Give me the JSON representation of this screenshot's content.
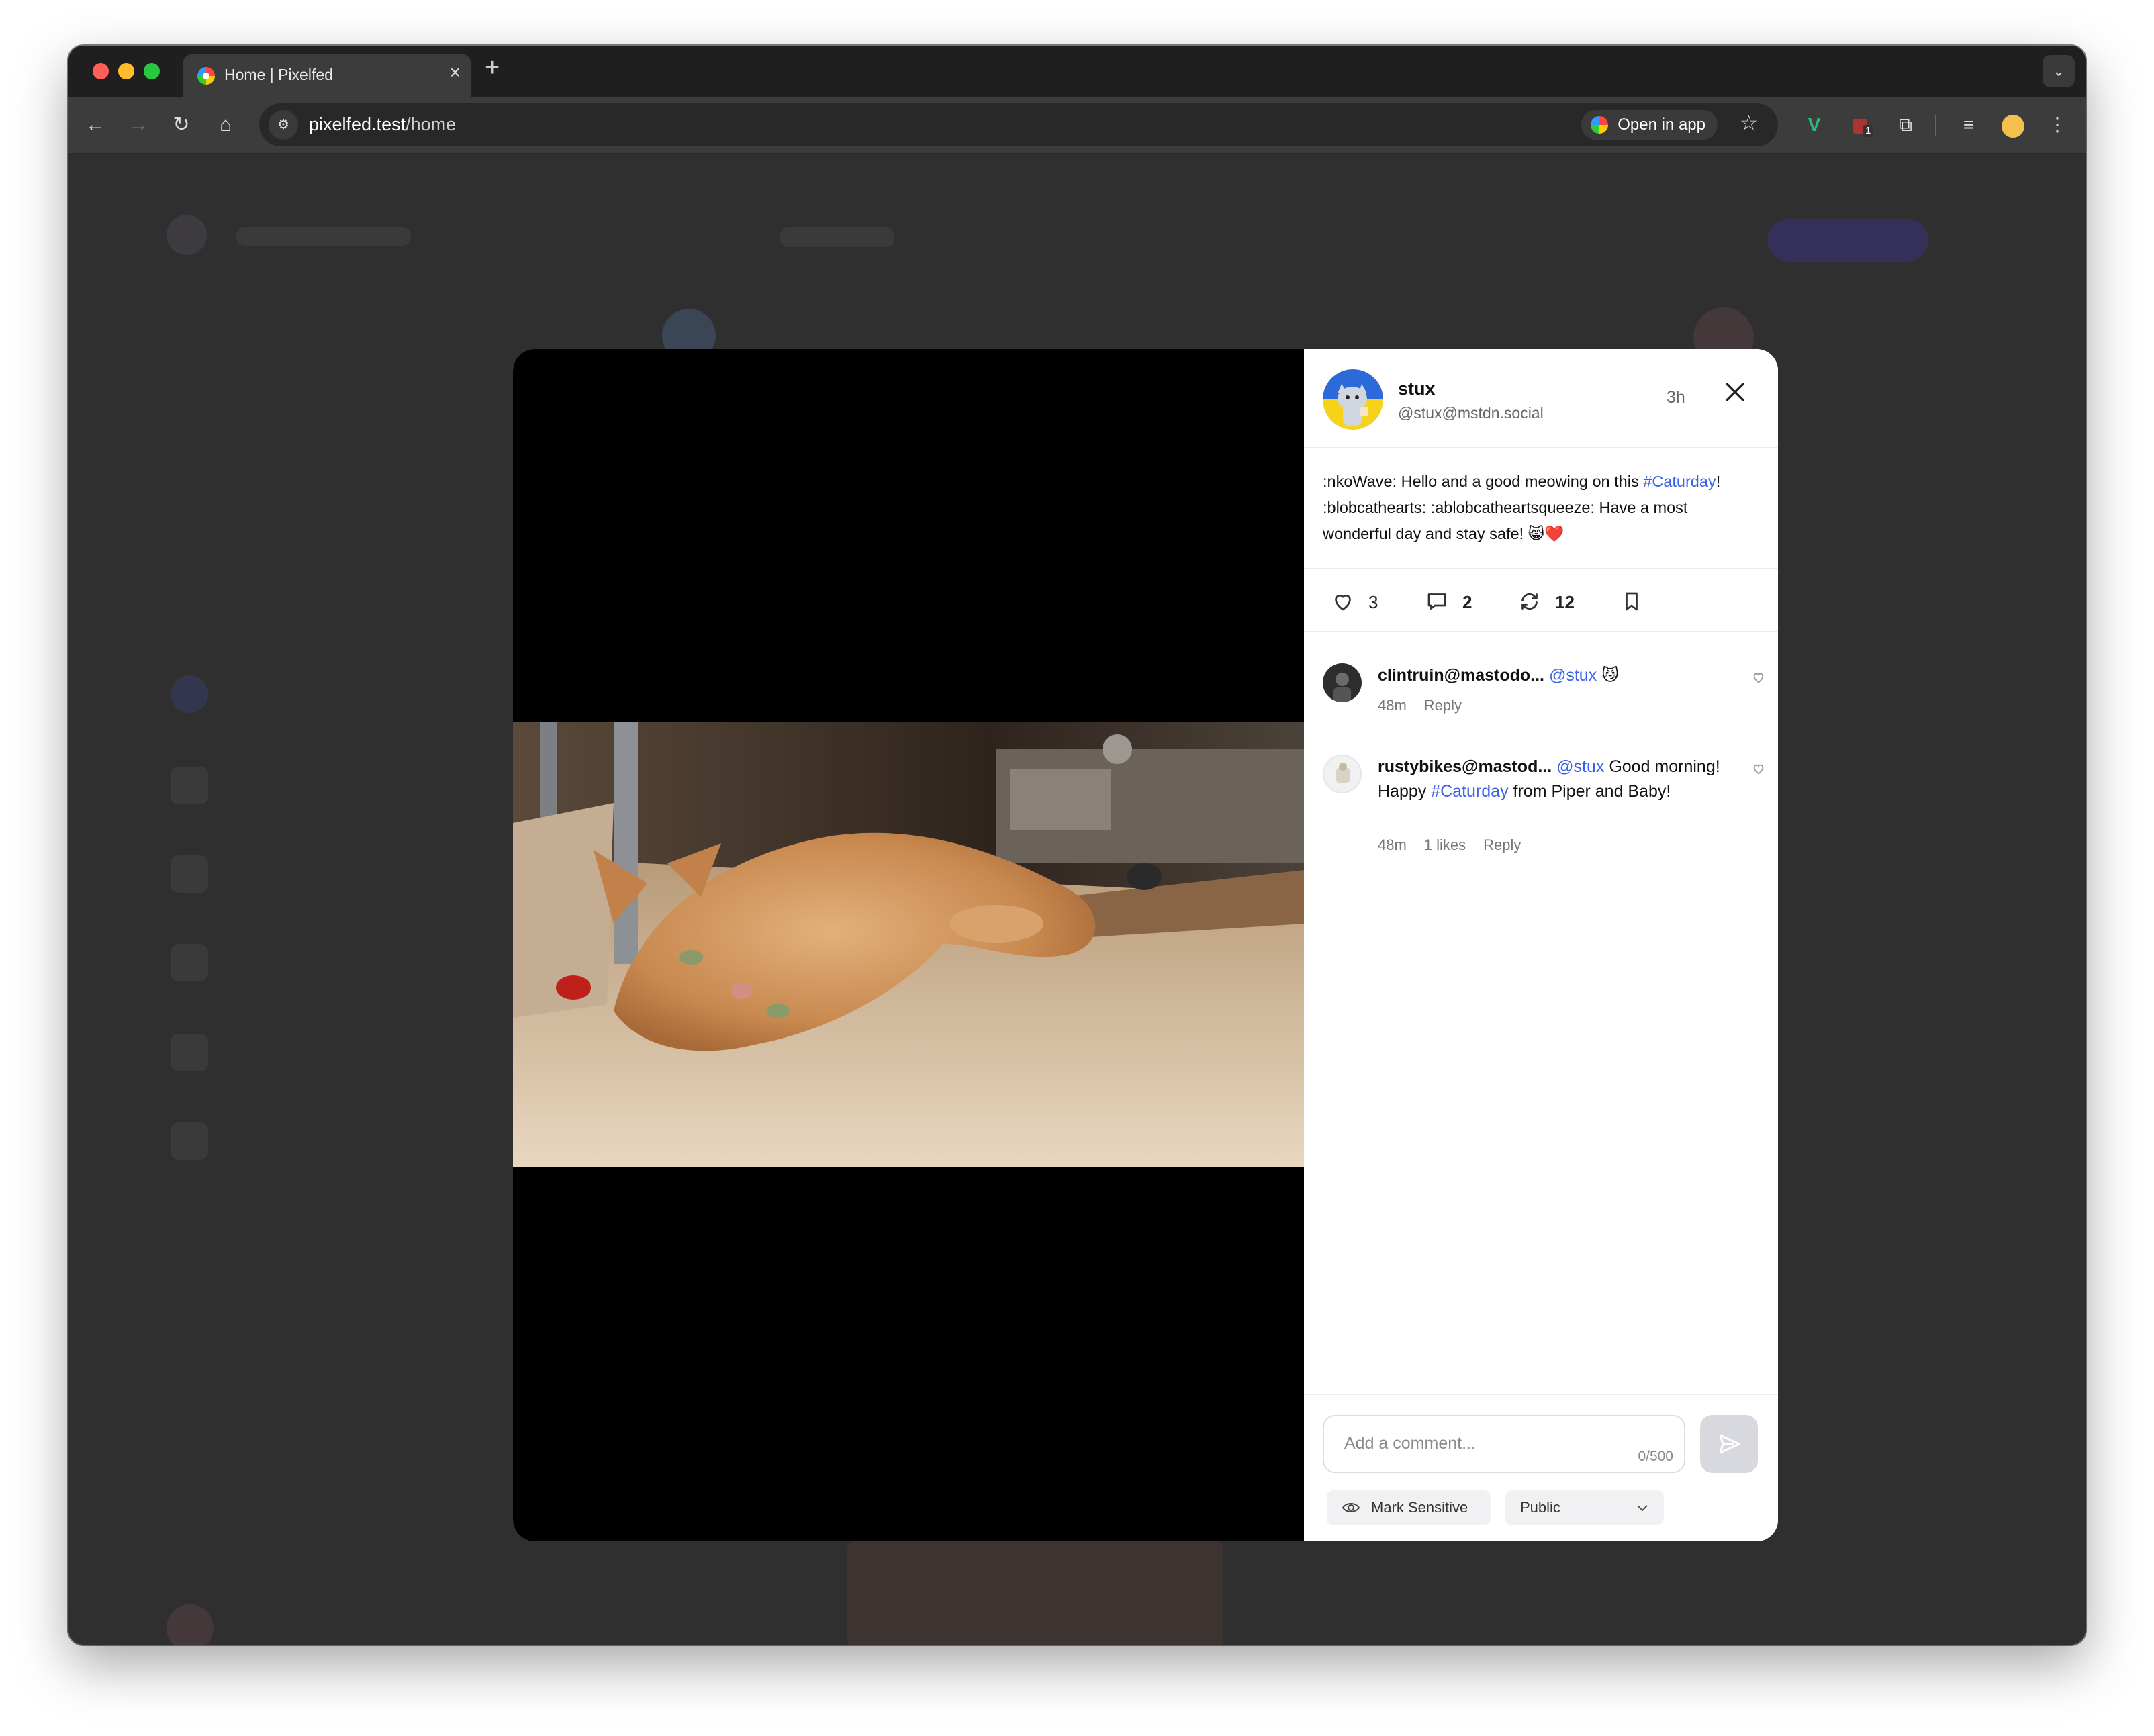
{
  "browser": {
    "tab_title": "Home | Pixelfed",
    "url_host": "pixelfed.test",
    "url_path": "/home",
    "open_in_app": "Open in app",
    "extension_badge": "1"
  },
  "post": {
    "author": "stux",
    "handle": "@stux@mstdn.social",
    "time": "3h",
    "caption": {
      "part1": ":nkoWave: Hello and a good meowing on this ",
      "hashtag": "#Caturday",
      "part2": "! :blobcathearts: :ablobcatheartsqueeze: Have a most wonderful day and stay safe! 😸❤️"
    },
    "likes": "3",
    "comments": "2",
    "shares": "12"
  },
  "comments": [
    {
      "user": "clintruin@mastodo...",
      "mention": "@stux",
      "text": " 😼",
      "time": "48m",
      "reply": "Reply"
    },
    {
      "user": "rustybikes@mastod...",
      "mention": "@stux",
      "text_before": " Good morning! Happy ",
      "hashtag": "#Caturday",
      "text_after": " from Piper and Baby!",
      "time": "48m",
      "likes": "1 likes",
      "reply": "Reply"
    }
  ],
  "composer": {
    "placeholder": "Add a comment...",
    "counter": "0/500",
    "mark_sensitive": "Mark Sensitive",
    "visibility": "Public"
  },
  "colors": {
    "link": "#3a62e8",
    "backdrop": "#2f2f2f",
    "chrome_dark": "#1f1f1f"
  }
}
